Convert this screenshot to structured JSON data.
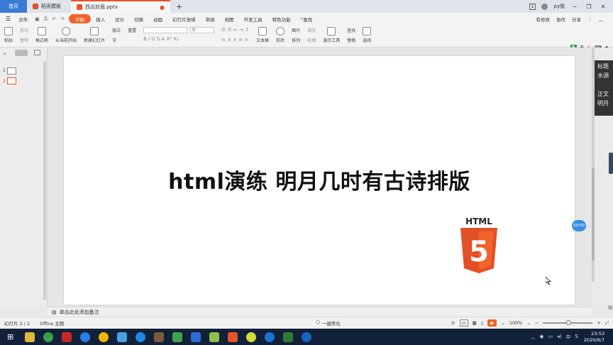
{
  "tabs": {
    "home": "首页",
    "template": "稻壳模板",
    "file": "西瓜封面.pptx",
    "add": "+"
  },
  "titlebar": {
    "badge": "1",
    "user": "py我"
  },
  "menu": {
    "items": [
      "文件",
      "开始",
      "插入",
      "设计",
      "切换",
      "动画",
      "幻灯片放映",
      "审阅",
      "视图",
      "开发工具",
      "特色功能",
      "查找"
    ],
    "active": "开始",
    "right": [
      "有修改",
      "协作",
      "分享"
    ]
  },
  "ribbon": {
    "paste": "粘贴",
    "cut": "剪切",
    "copy": "复制",
    "format_painter": "格式刷",
    "from_current": "从当前开始",
    "new_slide": "新建幻灯片",
    "layout": "版式",
    "section": "节",
    "reset": "重置",
    "font_size": "0",
    "textbox": "文本框",
    "shape": "形状",
    "arrange": "排列",
    "picture": "图片",
    "fill": "填充",
    "outline": "轮廓",
    "presenter_tools": "演示工具",
    "find": "查找",
    "replace": "替换",
    "select": "选择",
    "format_marks": "B  I  U  S  A  X²  X₂"
  },
  "ime": {
    "label": "五"
  },
  "slide": {
    "title": "html演练 明月几时有古诗排版",
    "html5_label": "HTML",
    "html5_number": "5"
  },
  "notes_popup": {
    "lines": [
      "标题",
      "水调",
      "",
      "正文",
      "明月"
    ]
  },
  "thumbnails": [
    "1",
    "2"
  ],
  "notes": {
    "placeholder": "单击此处添加备注"
  },
  "status": {
    "slide_count": "幻灯片 2 / 2",
    "theme": "Office 主题",
    "beautify": "一键美化",
    "zoom": "100%"
  },
  "timer": "00:00",
  "taskbar": {
    "time": "23:53",
    "date": "2020/9/7"
  },
  "colors": {
    "accent": "#f0622b",
    "home_tab": "#3a7bd5",
    "taskbar": "#12213a",
    "html5_orange": "#e34f26"
  }
}
